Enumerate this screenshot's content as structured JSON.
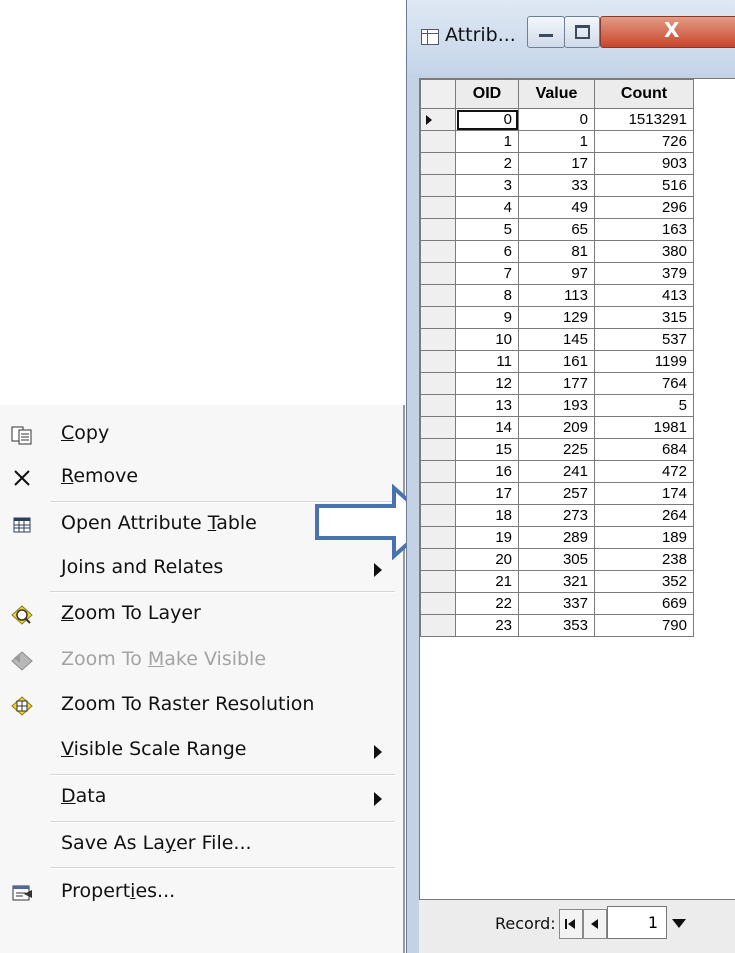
{
  "context_menu": {
    "items": [
      {
        "label_pre": "",
        "label_u": "C",
        "label_post": "opy",
        "icon": "copy-icon"
      },
      {
        "label_pre": "",
        "label_u": "R",
        "label_post": "emove",
        "icon": "remove-icon"
      },
      {
        "label_pre": "Open Attribute ",
        "label_u": "T",
        "label_post": "able",
        "icon": "table-icon"
      },
      {
        "label_pre": "",
        "label_u": "J",
        "label_post": "oins and Relates",
        "submenu": true
      },
      {
        "label_pre": "",
        "label_u": "Z",
        "label_post": "oom To Layer",
        "icon": "zoom-layer-icon"
      },
      {
        "label_pre": "Zoom To ",
        "label_u": "M",
        "label_post": "ake Visible",
        "icon": "zoom-visible-icon",
        "disabled": true
      },
      {
        "label_pre": "Zoom To Raster Resolution",
        "label_u": "",
        "label_post": "",
        "icon": "zoom-raster-icon"
      },
      {
        "label_pre": "",
        "label_u": "V",
        "label_post": "isible Scale Range",
        "submenu": true
      },
      {
        "label_pre": "",
        "label_u": "D",
        "label_post": "ata",
        "submenu": true
      },
      {
        "label_pre": "Save As La",
        "label_u": "y",
        "label_post": "er File...",
        "icon": ""
      },
      {
        "label_pre": "Propert",
        "label_u": "i",
        "label_post": "es...",
        "icon": "properties-icon"
      }
    ]
  },
  "attribute_window": {
    "title": "Attrib...",
    "close_glyph": "X",
    "columns": [
      "OID",
      "Value",
      "Count"
    ],
    "rows": [
      [
        "0",
        "0",
        "1513291"
      ],
      [
        "1",
        "1",
        "726"
      ],
      [
        "2",
        "17",
        "903"
      ],
      [
        "3",
        "33",
        "516"
      ],
      [
        "4",
        "49",
        "296"
      ],
      [
        "5",
        "65",
        "163"
      ],
      [
        "6",
        "81",
        "380"
      ],
      [
        "7",
        "97",
        "379"
      ],
      [
        "8",
        "113",
        "413"
      ],
      [
        "9",
        "129",
        "315"
      ],
      [
        "10",
        "145",
        "537"
      ],
      [
        "11",
        "161",
        "1199"
      ],
      [
        "12",
        "177",
        "764"
      ],
      [
        "13",
        "193",
        "5"
      ],
      [
        "14",
        "209",
        "1981"
      ],
      [
        "15",
        "225",
        "684"
      ],
      [
        "16",
        "241",
        "472"
      ],
      [
        "17",
        "257",
        "174"
      ],
      [
        "18",
        "273",
        "264"
      ],
      [
        "19",
        "289",
        "189"
      ],
      [
        "20",
        "305",
        "238"
      ],
      [
        "21",
        "321",
        "352"
      ],
      [
        "22",
        "337",
        "669"
      ],
      [
        "23",
        "353",
        "790"
      ]
    ],
    "record_label": "Record:",
    "record_value": "1"
  },
  "colors": {
    "arrow_stroke": "#4a72b0",
    "window_frame": "#c3d2e5",
    "close_button": "#c9452c"
  }
}
